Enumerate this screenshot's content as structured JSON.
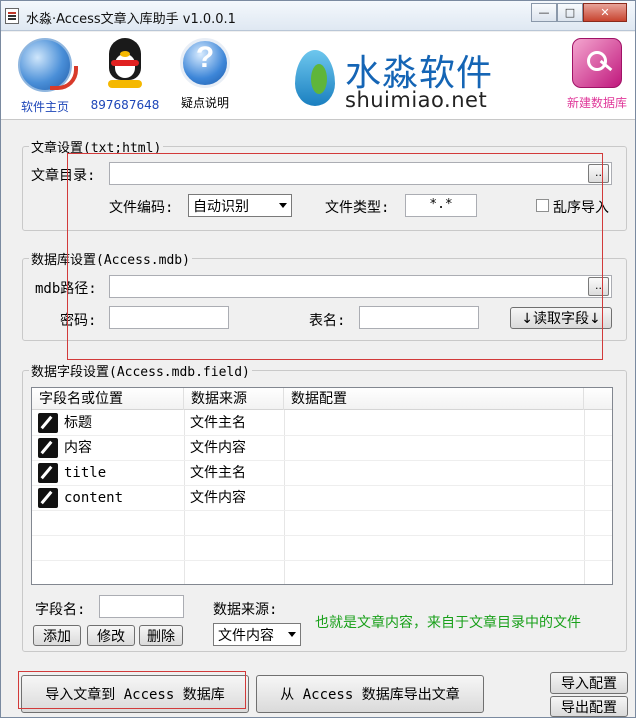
{
  "window": {
    "title": "水淼·Access文章入库助手 v1.0.0.1"
  },
  "toolbar": {
    "items": [
      {
        "label": "软件主页",
        "icon": "globe-icon"
      },
      {
        "label": "897687648",
        "icon": "qq-penguin-icon"
      },
      {
        "label": "疑点说明",
        "icon": "help-icon"
      },
      {
        "label": "新建数据库",
        "icon": "key-icon"
      }
    ],
    "brand_cn": "水淼软件",
    "brand_en": "shuimiao.net"
  },
  "article": {
    "group_title": "文章设置(txt;html)",
    "dir_label": "文章目录:",
    "dir_value": "",
    "browse": "..",
    "encoding_label": "文件编码:",
    "encoding_value": "自动识别",
    "type_label": "文件类型:",
    "type_value": "*.*",
    "shuffle_label": "乱序导入"
  },
  "database": {
    "group_title": "数据库设置(Access.mdb)",
    "path_label": "mdb路径:",
    "path_value": "",
    "browse": "..",
    "pwd_label": "密码:",
    "pwd_value": "",
    "table_label": "表名:",
    "table_value": "",
    "read_fields": "↓读取字段↓"
  },
  "fields": {
    "group_title": "数据字段设置(Access.mdb.field)",
    "columns": [
      "字段名或位置",
      "数据来源",
      "数据配置"
    ],
    "rows": [
      {
        "name": "标题",
        "source": "文件主名",
        "config": ""
      },
      {
        "name": "内容",
        "source": "文件内容",
        "config": ""
      },
      {
        "name": "title",
        "source": "文件主名",
        "config": ""
      },
      {
        "name": "content",
        "source": "文件内容",
        "config": ""
      }
    ],
    "field_name_label": "字段名:",
    "field_name_value": "",
    "source_label": "数据来源:",
    "source_value": "文件内容",
    "add": "添加",
    "modify": "修改",
    "delete": "删除",
    "hint": "也就是文章内容，来自于文章目录中的文件"
  },
  "actions": {
    "import": "导入文章到 Access 数据库",
    "export": "从 Access 数据库导出文章",
    "import_config": "导入配置",
    "export_config": "导出配置"
  },
  "colors": {
    "accent_blue": "#1d46b8",
    "accent_pink": "#e0389a",
    "hint_green": "#19a01a",
    "highlight_red": "#d23a3a"
  }
}
